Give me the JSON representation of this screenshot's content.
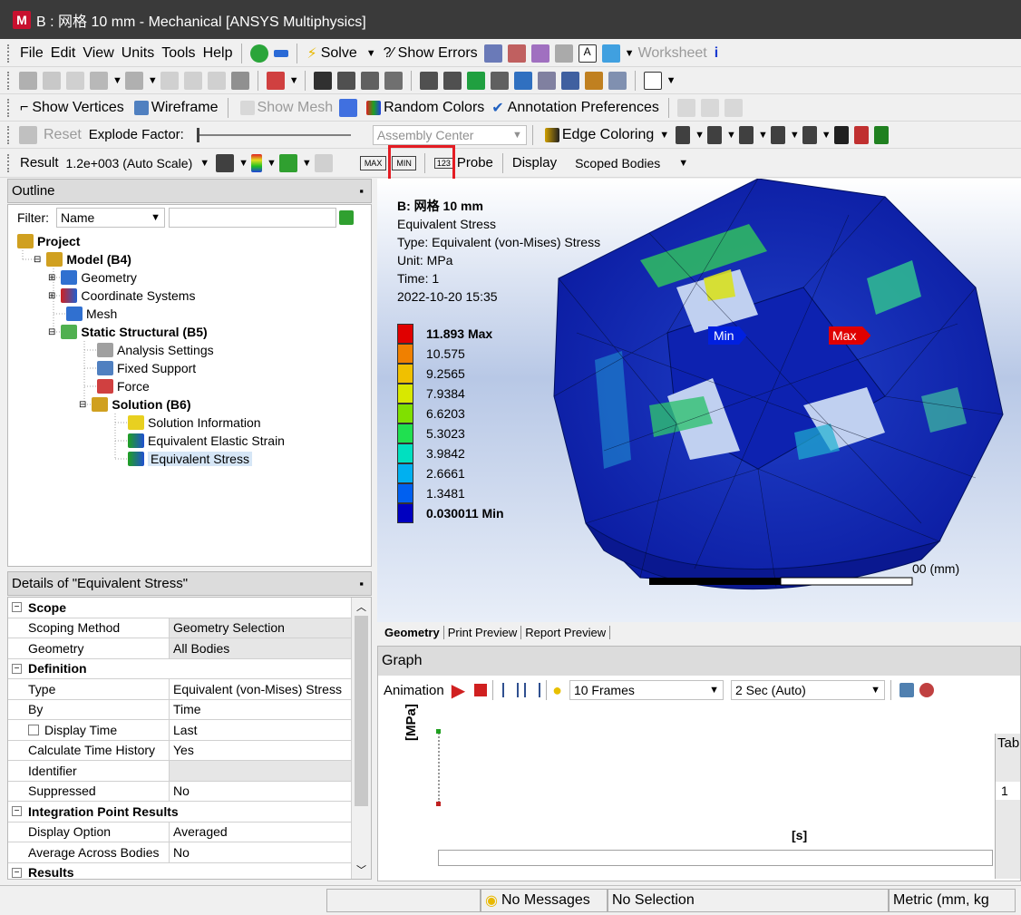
{
  "window": {
    "title": "B : 网格 10 mm - Mechanical [ANSYS Multiphysics]",
    "logo": "M"
  },
  "menu": {
    "items": [
      "File",
      "Edit",
      "View",
      "Units",
      "Tools",
      "Help"
    ],
    "solve": "Solve",
    "show_errors": "?⁄ Show Errors",
    "worksheet": "Worksheet"
  },
  "toolbar3": {
    "show_vertices": "Show Vertices",
    "wireframe": "Wireframe",
    "show_mesh": "Show Mesh",
    "random_colors": "Random Colors",
    "annotation_prefs": "Annotation Preferences"
  },
  "toolbar4": {
    "reset": "Reset",
    "explode_factor": "Explode Factor:",
    "assembly_center": "Assembly Center",
    "edge_coloring": "Edge Coloring"
  },
  "result_bar": {
    "result_label": "Result",
    "scale": "1.2e+003 (Auto Scale)",
    "max_btn": "MAX",
    "min_btn": "MIN",
    "probe": "Probe",
    "display_label": "Display",
    "display_value": "Scoped Bodies"
  },
  "outline": {
    "title": "Outline",
    "filter_label": "Filter:",
    "filter_value": "Name",
    "tree": [
      {
        "label": "Project",
        "bold": true
      },
      {
        "label": "Model (B4)",
        "bold": true
      },
      {
        "label": "Geometry"
      },
      {
        "label": "Coordinate Systems"
      },
      {
        "label": "Mesh"
      },
      {
        "label": "Static Structural (B5)",
        "bold": true
      },
      {
        "label": "Analysis Settings"
      },
      {
        "label": "Fixed Support"
      },
      {
        "label": "Force"
      },
      {
        "label": "Solution (B6)",
        "bold": true
      },
      {
        "label": "Solution Information"
      },
      {
        "label": "Equivalent Elastic Strain"
      },
      {
        "label": "Equivalent Stress",
        "selected": true
      }
    ]
  },
  "details": {
    "title": "Details of \"Equivalent Stress\"",
    "rows": [
      {
        "section": "Scope"
      },
      {
        "k": "Scoping Method",
        "v": "Geometry Selection",
        "shade": true
      },
      {
        "k": "Geometry",
        "v": "All Bodies",
        "shade": true
      },
      {
        "section": "Definition"
      },
      {
        "k": "Type",
        "v": "Equivalent (von-Mises) Stress"
      },
      {
        "k": "By",
        "v": "Time"
      },
      {
        "k": "Display Time",
        "v": "Last",
        "checkbox": true
      },
      {
        "k": "Calculate Time History",
        "v": "Yes"
      },
      {
        "k": "Identifier",
        "v": "",
        "shade": true
      },
      {
        "k": "Suppressed",
        "v": "No"
      },
      {
        "section": "Integration Point Results"
      },
      {
        "k": "Display Option",
        "v": "Averaged"
      },
      {
        "k": "Average Across Bodies",
        "v": "No"
      },
      {
        "section": "Results"
      }
    ]
  },
  "viewport": {
    "info": [
      "B: 网格 10 mm",
      "Equivalent Stress",
      "Type: Equivalent (von-Mises) Stress",
      "Unit: MPa",
      "Time: 1",
      "2022-10-20 15:35"
    ],
    "legend": [
      {
        "label": "11.893 Max",
        "color": "#e00000"
      },
      {
        "label": "10.575",
        "color": "#f08000"
      },
      {
        "label": "9.2565",
        "color": "#f0c000"
      },
      {
        "label": "7.9384",
        "color": "#d8e800"
      },
      {
        "label": "6.6203",
        "color": "#80e000"
      },
      {
        "label": "5.3023",
        "color": "#20e050"
      },
      {
        "label": "3.9842",
        "color": "#00e0c0"
      },
      {
        "label": "2.6661",
        "color": "#00b0f0"
      },
      {
        "label": "1.3481",
        "color": "#0060f0"
      },
      {
        "label": "0.030011 Min",
        "color": "#0000c0"
      }
    ],
    "min_tag": "Min",
    "max_tag": "Max",
    "scale_unit": "00 (mm)",
    "tabs": [
      "Geometry",
      "Print Preview",
      "Report Preview"
    ]
  },
  "graph": {
    "title": "Graph",
    "animation": "Animation",
    "frames": "10 Frames",
    "duration": "2 Sec (Auto)",
    "y_label": "[MPa]",
    "x_label": "[s]",
    "table_tab": "Tab",
    "table_row": "1"
  },
  "status": {
    "messages": "No Messages",
    "selection": "No Selection",
    "units": "Metric (mm, kg"
  }
}
